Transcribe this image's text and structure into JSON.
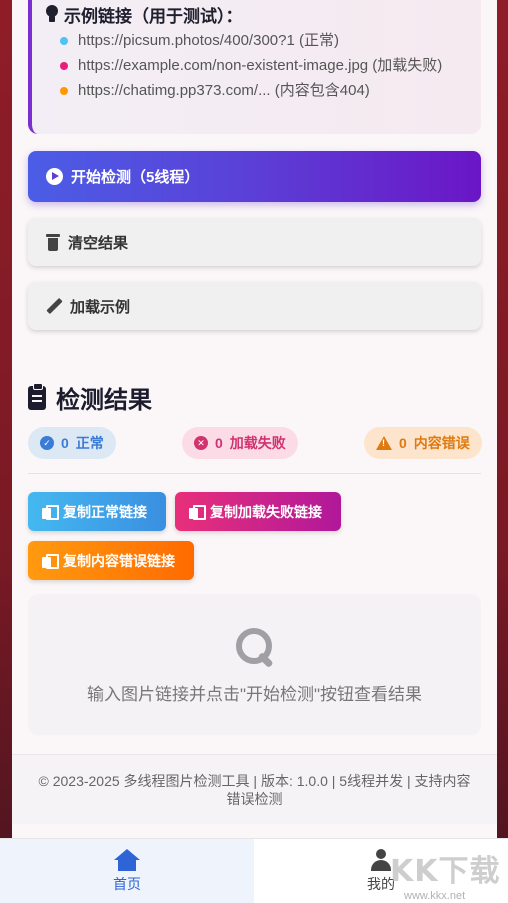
{
  "examples": {
    "title": "示例链接（用于测试）：",
    "items": [
      {
        "text": "https://picsum.photos/400/300?1 (正常)",
        "color": "#4fc3f7"
      },
      {
        "text": "https://example.com/non-existent-image.jpg (加载失败)",
        "color": "#e91e7a"
      },
      {
        "text": "https://chatimg.pp373.com/... (内容包含404)",
        "color": "#ff9800"
      }
    ]
  },
  "actions": {
    "start_label": "开始检测（5线程）",
    "clear_label": "清空结果",
    "load_label": "加载示例"
  },
  "results": {
    "title": "检测结果",
    "ok": {
      "count": "0",
      "label": "正常"
    },
    "fail": {
      "count": "0",
      "label": "加载失败"
    },
    "error": {
      "count": "0",
      "label": "内容错误"
    },
    "copy_ok_label": "复制正常链接",
    "copy_fail_label": "复制加载失败链接",
    "copy_error_label": "复制内容错误链接",
    "empty_text": "输入图片链接并点击\"开始检测\"按钮查看结果"
  },
  "footer": {
    "text": "© 2023-2025 多线程图片检测工具 | 版本: 1.0.0 | 5线程并发 | 支持内容错误检测"
  },
  "tabs": {
    "home": "首页",
    "mine": "我的"
  },
  "watermark": {
    "main": "KK下载",
    "url": "www.kkx.net"
  },
  "colors": {
    "accent": "#5b3fd6",
    "tab_active": "#2f64d6"
  }
}
